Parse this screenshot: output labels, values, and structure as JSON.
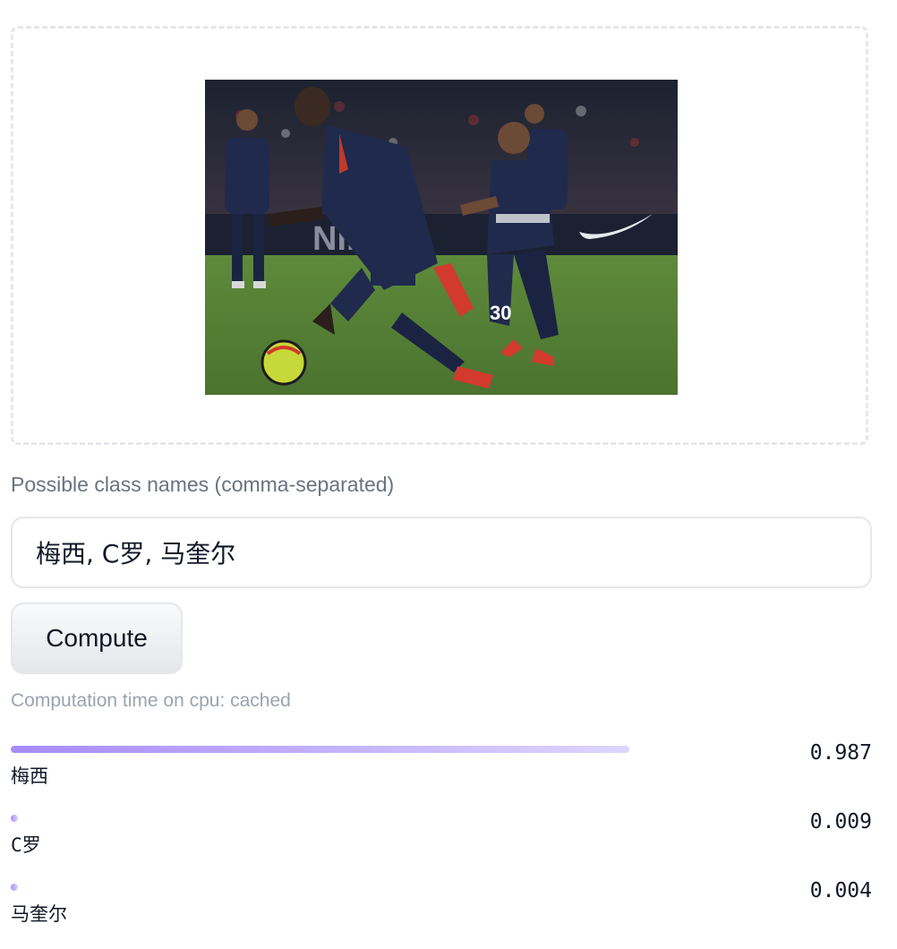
{
  "image_panel": {
    "icon": "photo-of-soccer-match"
  },
  "class_names": {
    "label": "Possible class names (comma-separated)",
    "value": "梅西, C罗, 马奎尔"
  },
  "compute_button": {
    "label": "Compute"
  },
  "timing_text": "Computation time on cpu: cached",
  "results": [
    {
      "label": "梅西",
      "score": "0.987",
      "fraction": 0.987
    },
    {
      "label": "C罗",
      "score": "0.009",
      "fraction": 0.009
    },
    {
      "label": "马奎尔",
      "score": "0.004",
      "fraction": 0.004
    }
  ],
  "colors": {
    "bar_start": "#a78bfa",
    "bar_end": "#ddd6fe",
    "border": "#e5e7eb",
    "muted_text": "#6b7280"
  }
}
